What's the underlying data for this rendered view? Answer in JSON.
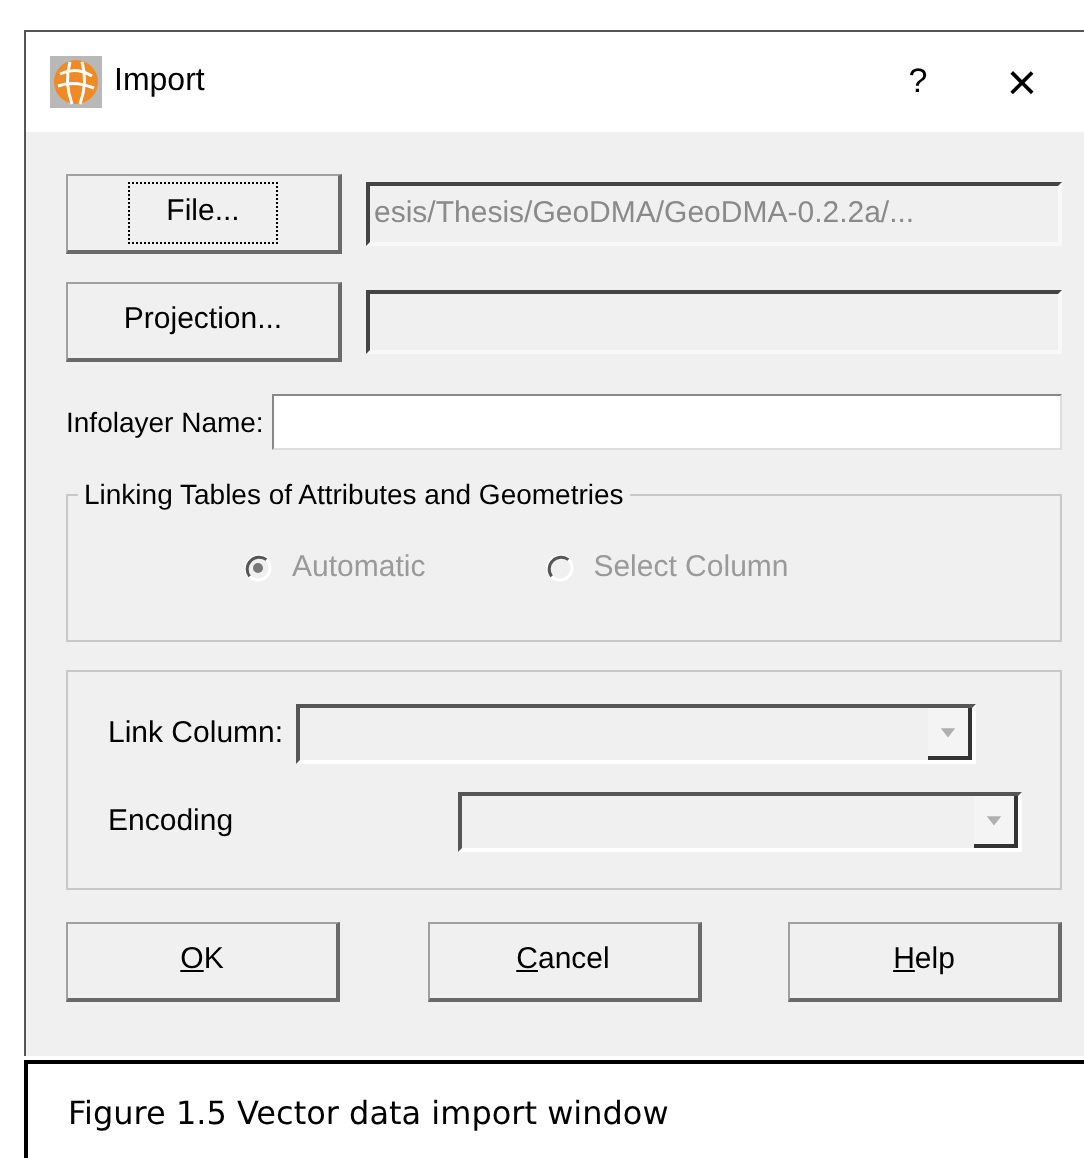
{
  "window": {
    "title": "Import",
    "help_button": "?",
    "close_button": "×"
  },
  "file_button": {
    "label": "File...",
    "focused": true
  },
  "file_field": {
    "value": "esis/Thesis/GeoDMA/GeoDMA-0.2.2a/...",
    "disabled": true
  },
  "projection_button": {
    "label": "Projection..."
  },
  "projection_field": {
    "disabled": true
  },
  "infolayer": {
    "label": "Infolayer Name:"
  },
  "linking_group": {
    "title": "Linking Tables of Attributes and Geometries",
    "options": [
      {
        "label": "Automatic",
        "selected": true,
        "disabled": true
      },
      {
        "label": "Select Column",
        "selected": false,
        "disabled": true
      }
    ]
  },
  "link_column": {
    "label": "Link Column:",
    "disabled": true
  },
  "encoding": {
    "label": "Encoding",
    "disabled": true
  },
  "buttons": [
    {
      "mnemonic": "O",
      "rest": "K"
    },
    {
      "mnemonic": "C",
      "rest": "ancel"
    },
    {
      "mnemonic": "H",
      "rest": "elp"
    }
  ],
  "caption": "Figure 1.5 Vector data import window"
}
